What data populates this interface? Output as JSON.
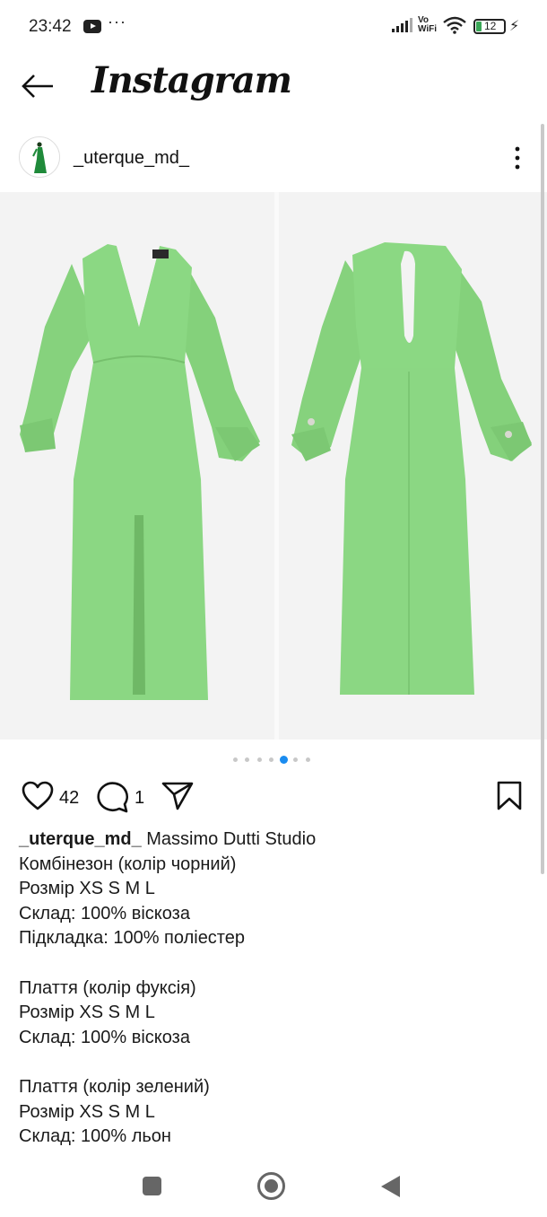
{
  "status_bar": {
    "time": "23:42",
    "more": "···",
    "network_label_top": "Vo",
    "network_label_bottom": "WiFi",
    "battery": "12",
    "icons": [
      "youtube-icon",
      "signal-icon",
      "vowifi-icon",
      "wifi-icon",
      "battery-icon",
      "charging-icon"
    ]
  },
  "header": {
    "app_name": "Instagram",
    "back_icon": "arrow-left-icon"
  },
  "post": {
    "username": "_uterque_md_",
    "options_icon": "more-vertical-icon",
    "carousel": {
      "total_slides": 6,
      "active_slide": 5,
      "images": [
        "green-dress-front-photo",
        "green-dress-back-photo"
      ],
      "dress_color": "#8cd882"
    },
    "actions": {
      "likes": "42",
      "comments": "1",
      "icons": [
        "heart-icon",
        "comment-icon",
        "share-icon",
        "bookmark-icon"
      ]
    },
    "caption": {
      "username": "_uterque_md_",
      "first_line_text": " Massimo Dutti Studio",
      "lines": [
        "Комбінезон (колір чорний)",
        "Розмір XS S M L",
        "Склад: 100% віскоза",
        "Підкладка: 100% поліестер",
        "",
        "Плаття (колір фуксія)",
        "Розмір XS S M L",
        "Склад: 100% віскоза",
        "",
        "Плаття (колір зелений)",
        "Розмір XS S M L",
        "Склад: 100% льон"
      ]
    }
  },
  "nav_bar": {
    "icons": [
      "recents-square-icon",
      "home-circle-icon",
      "back-triangle-icon"
    ]
  },
  "colors": {
    "accent": "#1a8cf0",
    "battery_fill": "#3aa757"
  }
}
